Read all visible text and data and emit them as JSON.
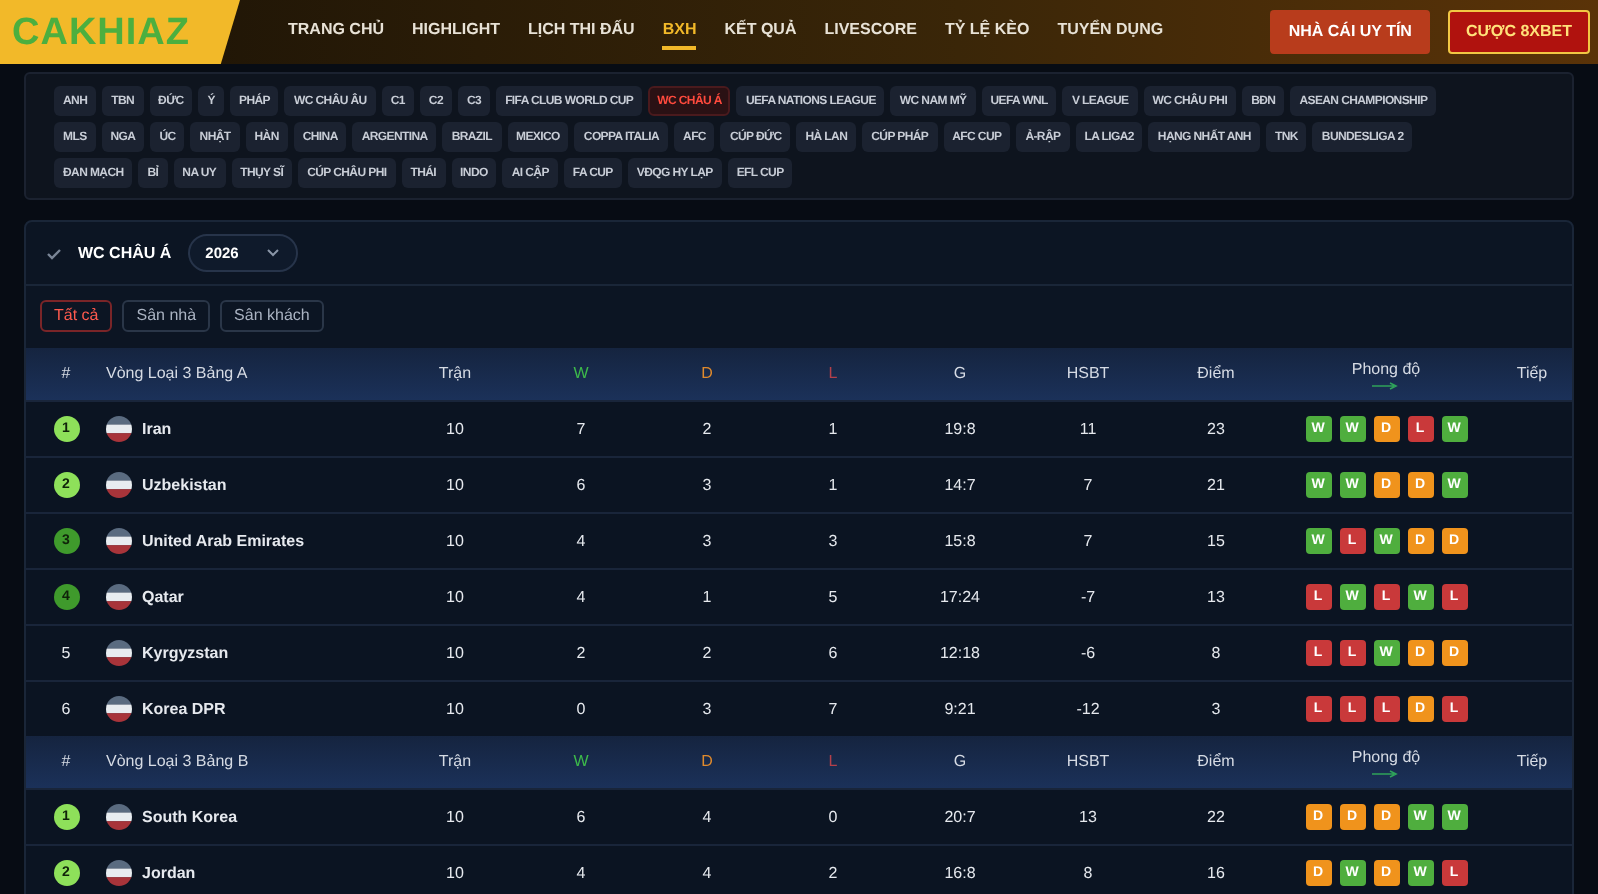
{
  "logo": "CAKHIAZ",
  "nav": [
    {
      "label": "TRANG CHỦ",
      "selected": false
    },
    {
      "label": "HIGHLIGHT",
      "selected": false
    },
    {
      "label": "LỊCH THI ĐẤU",
      "selected": false
    },
    {
      "label": "BXH",
      "selected": true
    },
    {
      "label": "KẾT QUẢ",
      "selected": false
    },
    {
      "label": "LIVESCORE",
      "selected": false
    },
    {
      "label": "TỶ LỆ KÈO",
      "selected": false
    },
    {
      "label": "TUYỂN DỤNG",
      "selected": false
    }
  ],
  "header_buttons": [
    {
      "label": "NHÀ CÁI UY TÍN",
      "kind": "plain"
    },
    {
      "label": "CƯỢC 8XBET",
      "kind": "highlight"
    }
  ],
  "leagues": [
    [
      {
        "label": "ANH",
        "selected": false
      },
      {
        "label": "TBN",
        "selected": false
      },
      {
        "label": "ĐỨC",
        "selected": false
      },
      {
        "label": "Ý",
        "selected": false
      },
      {
        "label": "PHÁP",
        "selected": false
      },
      {
        "label": "WC CHÂU ÂU",
        "selected": false
      },
      {
        "label": "C1",
        "selected": false
      },
      {
        "label": "C2",
        "selected": false
      },
      {
        "label": "C3",
        "selected": false
      },
      {
        "label": "FIFA CLUB WORLD CUP",
        "selected": false
      },
      {
        "label": "WC CHÂU Á",
        "selected": true
      },
      {
        "label": "UEFA NATIONS LEAGUE",
        "selected": false
      },
      {
        "label": "WC NAM MỸ",
        "selected": false
      },
      {
        "label": "UEFA WNL",
        "selected": false
      },
      {
        "label": "V LEAGUE",
        "selected": false
      },
      {
        "label": "WC CHÂU PHI",
        "selected": false
      },
      {
        "label": "BĐN",
        "selected": false
      },
      {
        "label": "ASEAN CHAMPIONSHIP",
        "selected": false
      }
    ],
    [
      {
        "label": "MLS",
        "selected": false
      },
      {
        "label": "NGA",
        "selected": false
      },
      {
        "label": "ÚC",
        "selected": false
      },
      {
        "label": "NHẬT",
        "selected": false
      },
      {
        "label": "HÀN",
        "selected": false
      },
      {
        "label": "CHINA",
        "selected": false
      },
      {
        "label": "ARGENTINA",
        "selected": false
      },
      {
        "label": "BRAZIL",
        "selected": false
      },
      {
        "label": "MEXICO",
        "selected": false
      },
      {
        "label": "COPPA ITALIA",
        "selected": false
      },
      {
        "label": "AFC",
        "selected": false
      },
      {
        "label": "CÚP ĐỨC",
        "selected": false
      },
      {
        "label": "HÀ LAN",
        "selected": false
      },
      {
        "label": "CÚP PHÁP",
        "selected": false
      },
      {
        "label": "AFC CUP",
        "selected": false
      },
      {
        "label": "Ả-RẬP",
        "selected": false
      },
      {
        "label": "LA LIGA2",
        "selected": false
      },
      {
        "label": "HẠNG NHẤT ANH",
        "selected": false
      },
      {
        "label": "TNK",
        "selected": false
      },
      {
        "label": "BUNDESLIGA 2",
        "selected": false
      }
    ],
    [
      {
        "label": "ĐAN MẠCH",
        "selected": false
      },
      {
        "label": "BỈ",
        "selected": false
      },
      {
        "label": "NA UY",
        "selected": false
      },
      {
        "label": "THỤY SĨ",
        "selected": false
      },
      {
        "label": "CÚP CHÂU PHI",
        "selected": false
      },
      {
        "label": "THÁI",
        "selected": false
      },
      {
        "label": "INDO",
        "selected": false
      },
      {
        "label": "AI CẬP",
        "selected": false
      },
      {
        "label": "FA CUP",
        "selected": false
      },
      {
        "label": "VĐQG HY LẠP",
        "selected": false
      },
      {
        "label": "EFL CUP",
        "selected": false
      }
    ]
  ],
  "competition": {
    "title": "WC CHÂU Á",
    "season": "2026"
  },
  "filters": [
    {
      "label": "Tất cả",
      "selected": true
    },
    {
      "label": "Sân nhà",
      "selected": false
    },
    {
      "label": "Sân khách",
      "selected": false
    }
  ],
  "groups": [
    {
      "columns": [
        "#",
        "Vòng Loại 3 Bảng A",
        "Trận",
        "W",
        "D",
        "L",
        "G",
        "HSBT",
        "Điểm",
        "Phong độ",
        "Tiếp"
      ],
      "rows": [
        {
          "rank": "1",
          "color": "#8ee05a",
          "team": "Iran",
          "played": "10",
          "w": "7",
          "d": "2",
          "l": "1",
          "g": "19:8",
          "hsbt": "11",
          "pts": "23",
          "form": [
            {
              "label": "W",
              "kind": "win"
            },
            {
              "label": "W",
              "kind": "win"
            },
            {
              "label": "D",
              "kind": "draw"
            },
            {
              "label": "L",
              "kind": "loss"
            },
            {
              "label": "W",
              "kind": "win"
            }
          ]
        },
        {
          "rank": "2",
          "color": "#8ee05a",
          "team": "Uzbekistan",
          "played": "10",
          "w": "6",
          "d": "3",
          "l": "1",
          "g": "14:7",
          "hsbt": "7",
          "pts": "21",
          "form": [
            {
              "label": "W",
              "kind": "win"
            },
            {
              "label": "W",
              "kind": "win"
            },
            {
              "label": "D",
              "kind": "draw"
            },
            {
              "label": "D",
              "kind": "draw"
            },
            {
              "label": "W",
              "kind": "win"
            }
          ]
        },
        {
          "rank": "3",
          "color": "#3f9a2c",
          "team": "United Arab Emirates",
          "played": "10",
          "w": "4",
          "d": "3",
          "l": "3",
          "g": "15:8",
          "hsbt": "7",
          "pts": "15",
          "form": [
            {
              "label": "W",
              "kind": "win"
            },
            {
              "label": "L",
              "kind": "loss"
            },
            {
              "label": "W",
              "kind": "win"
            },
            {
              "label": "D",
              "kind": "draw"
            },
            {
              "label": "D",
              "kind": "draw"
            }
          ]
        },
        {
          "rank": "4",
          "color": "#3f9a2c",
          "team": "Qatar",
          "played": "10",
          "w": "4",
          "d": "1",
          "l": "5",
          "g": "17:24",
          "hsbt": "-7",
          "pts": "13",
          "form": [
            {
              "label": "L",
              "kind": "loss"
            },
            {
              "label": "W",
              "kind": "win"
            },
            {
              "label": "L",
              "kind": "loss"
            },
            {
              "label": "W",
              "kind": "win"
            },
            {
              "label": "L",
              "kind": "loss"
            }
          ]
        },
        {
          "rank": "5",
          "team": "Kyrgyzstan",
          "played": "10",
          "w": "2",
          "d": "2",
          "l": "6",
          "g": "12:18",
          "hsbt": "-6",
          "pts": "8",
          "form": [
            {
              "label": "L",
              "kind": "loss"
            },
            {
              "label": "L",
              "kind": "loss"
            },
            {
              "label": "W",
              "kind": "win"
            },
            {
              "label": "D",
              "kind": "draw"
            },
            {
              "label": "D",
              "kind": "draw"
            }
          ]
        },
        {
          "rank": "6",
          "team": "Korea DPR",
          "played": "10",
          "w": "0",
          "d": "3",
          "l": "7",
          "g": "9:21",
          "hsbt": "-12",
          "pts": "3",
          "form": [
            {
              "label": "L",
              "kind": "loss"
            },
            {
              "label": "L",
              "kind": "loss"
            },
            {
              "label": "L",
              "kind": "loss"
            },
            {
              "label": "D",
              "kind": "draw"
            },
            {
              "label": "L",
              "kind": "loss"
            }
          ]
        }
      ]
    },
    {
      "columns": [
        "#",
        "Vòng Loại 3 Bảng B",
        "Trận",
        "W",
        "D",
        "L",
        "G",
        "HSBT",
        "Điểm",
        "Phong độ",
        "Tiếp"
      ],
      "rows": [
        {
          "rank": "1",
          "color": "#8ee05a",
          "team": "South Korea",
          "played": "10",
          "w": "6",
          "d": "4",
          "l": "0",
          "g": "20:7",
          "hsbt": "13",
          "pts": "22",
          "form": [
            {
              "label": "D",
              "kind": "draw"
            },
            {
              "label": "D",
              "kind": "draw"
            },
            {
              "label": "D",
              "kind": "draw"
            },
            {
              "label": "W",
              "kind": "win"
            },
            {
              "label": "W",
              "kind": "win"
            }
          ]
        },
        {
          "rank": "2",
          "color": "#8ee05a",
          "team": "Jordan",
          "played": "10",
          "w": "4",
          "d": "4",
          "l": "2",
          "g": "16:8",
          "hsbt": "8",
          "pts": "16",
          "form": [
            {
              "label": "D",
              "kind": "draw"
            },
            {
              "label": "W",
              "kind": "win"
            },
            {
              "label": "D",
              "kind": "draw"
            },
            {
              "label": "W",
              "kind": "win"
            },
            {
              "label": "L",
              "kind": "loss"
            }
          ]
        }
      ]
    }
  ]
}
